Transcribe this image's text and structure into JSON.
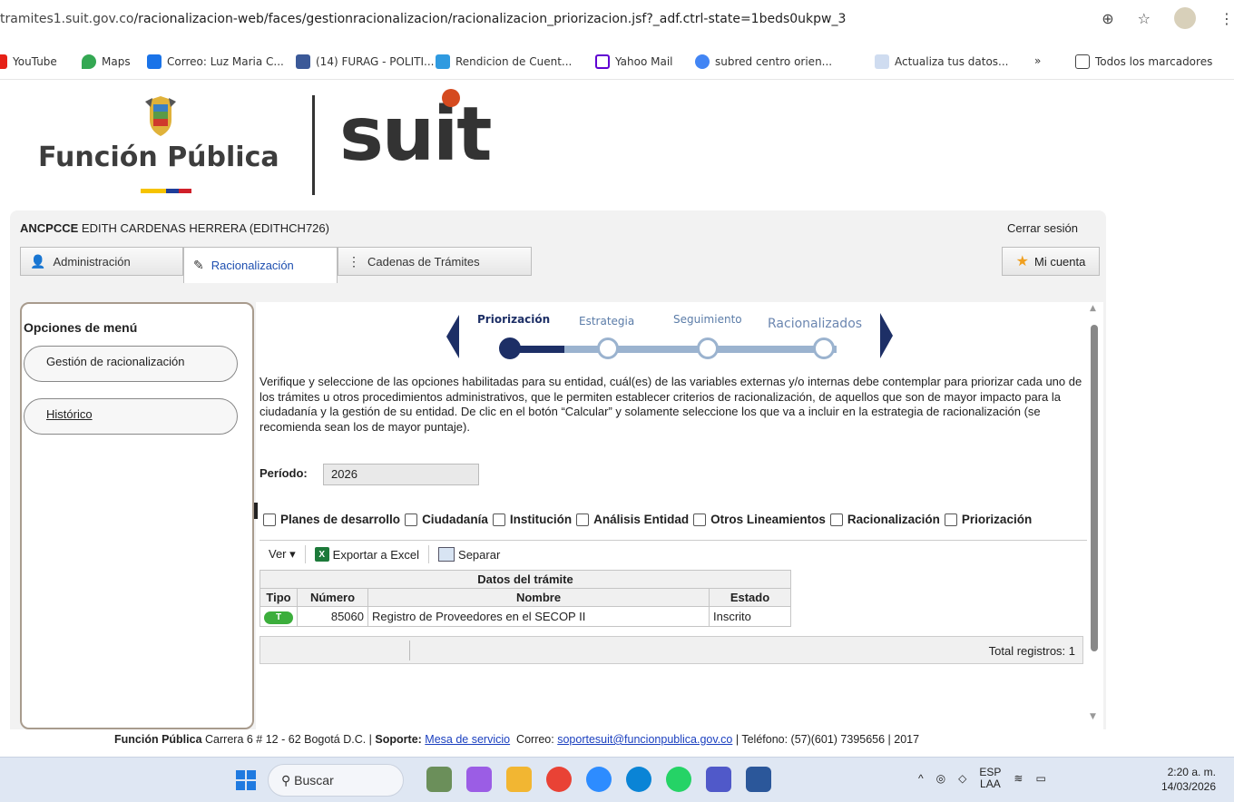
{
  "browser": {
    "url_prefix": "tramites1.suit.gov.co",
    "url_rest": "/racionalizacion-web/faces/gestionracionalizacion/racionalizacion_priorizacion.jsf?_adf.ctrl-state=1beds0ukpw_3",
    "bookmarks": [
      {
        "label": "YouTube",
        "color": "#e62117"
      },
      {
        "label": "Maps",
        "color": "#34a853"
      },
      {
        "label": "Correo: Luz Maria C...",
        "color": "#1a73e8"
      },
      {
        "label": "(14) FURAG - POLITI...",
        "color": "#3b5998"
      },
      {
        "label": "Rendicion de Cuent...",
        "color": "#2f9ae0"
      },
      {
        "label": "Yahoo Mail",
        "color": "#6001d2"
      },
      {
        "label": "subred centro orien...",
        "color": "#4285f4"
      },
      {
        "label": "Actualiza tus datos...",
        "color": "#5b8dd6"
      }
    ],
    "overflow": "»",
    "all_bookmarks": "Todos los marcadores"
  },
  "header": {
    "funcion_publica": "Función Pública",
    "suit": "suit",
    "user_entity": "ANCPCCE",
    "user_name": "EDITH CARDENAS HERRERA (EDITHCH726)",
    "logout": "Cerrar sesión"
  },
  "tabs": [
    {
      "label": "Administración"
    },
    {
      "label": "Racionalización"
    },
    {
      "label": "Cadenas de Trámites"
    }
  ],
  "account": "Mi cuenta",
  "menu": {
    "title": "Opciones de menú",
    "items": [
      "Gestión de racionalización",
      "Histórico"
    ]
  },
  "steps": [
    "Priorización",
    "Estrategia",
    "Seguimiento",
    "Racionalizados"
  ],
  "description": "Verifique y seleccione de las opciones habilitadas para su entidad, cuál(es) de las variables externas y/o internas debe contemplar para priorizar cada uno de los trámites u otros procedimientos administrativos, que le permiten establecer criterios de racionalización, de aquellos que son de mayor impacto para la ciudadanía y la gestión de su entidad. De clic en el botón “Calcular” y solamente seleccione los que va a incluir en la estrategia de racionalización (se recomienda sean los de mayor puntaje).",
  "period": {
    "label": "Período:",
    "value": "2026"
  },
  "filters": [
    "Planes de desarrollo",
    "Ciudadanía",
    "Institución",
    "Análisis Entidad",
    "Otros Lineamientos",
    "Racionalización",
    "Priorización"
  ],
  "toolbar": {
    "view": "Ver ▾",
    "export": "Exportar a Excel",
    "split": "Separar"
  },
  "table": {
    "group_header": "Datos del trámite",
    "columns": [
      "Tipo",
      "Número",
      "Nombre",
      "Estado"
    ],
    "rows": [
      {
        "tipo": "T",
        "numero": "85060",
        "nombre": "Registro de Proveedores en el SECOP II",
        "estado": "Inscrito"
      }
    ],
    "total": "Total registros: 1"
  },
  "footer": {
    "org": "Función Pública",
    "address": "Carrera 6 # 12 - 62 Bogotá D.C. |",
    "support_label": "Soporte:",
    "support_link": "Mesa de servicio",
    "mail_label": "Correo:",
    "mail": "soportesuit@funcionpublica.gov.co",
    "phone": "| Teléfono: (57)(601) 7395656 | 2017"
  },
  "taskbar": {
    "search": "Buscar",
    "lang": "ESP",
    "lang2": "LAA",
    "time": "2:20 a. m.",
    "date": "14/03/2026"
  }
}
